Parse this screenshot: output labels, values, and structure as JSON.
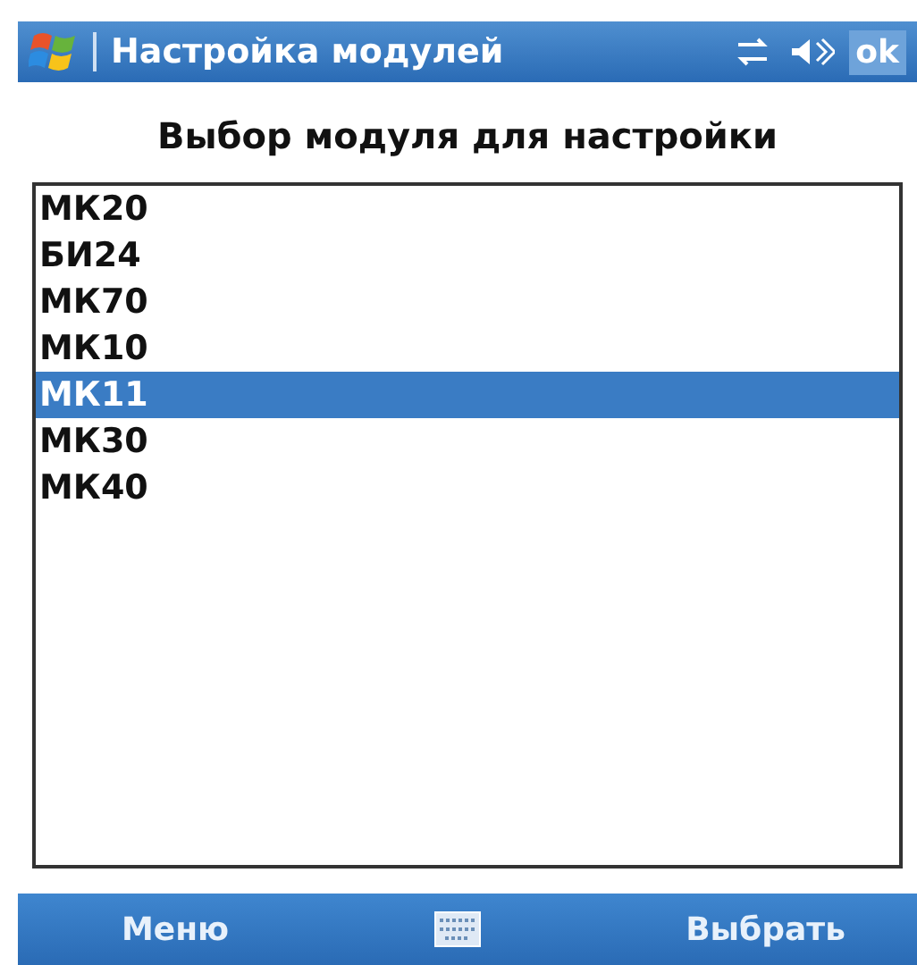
{
  "title_bar": {
    "title": "Настройка модулей",
    "ok": "ok"
  },
  "heading": "Выбор модуля для настройки",
  "modules": [
    {
      "label": "МК20",
      "selected": false
    },
    {
      "label": "БИ24",
      "selected": false
    },
    {
      "label": "МК70",
      "selected": false
    },
    {
      "label": "МК10",
      "selected": false
    },
    {
      "label": "МК11",
      "selected": true
    },
    {
      "label": "МК30",
      "selected": false
    },
    {
      "label": "МК40",
      "selected": false
    }
  ],
  "softkeys": {
    "left": "Меню",
    "right": "Выбрать"
  }
}
